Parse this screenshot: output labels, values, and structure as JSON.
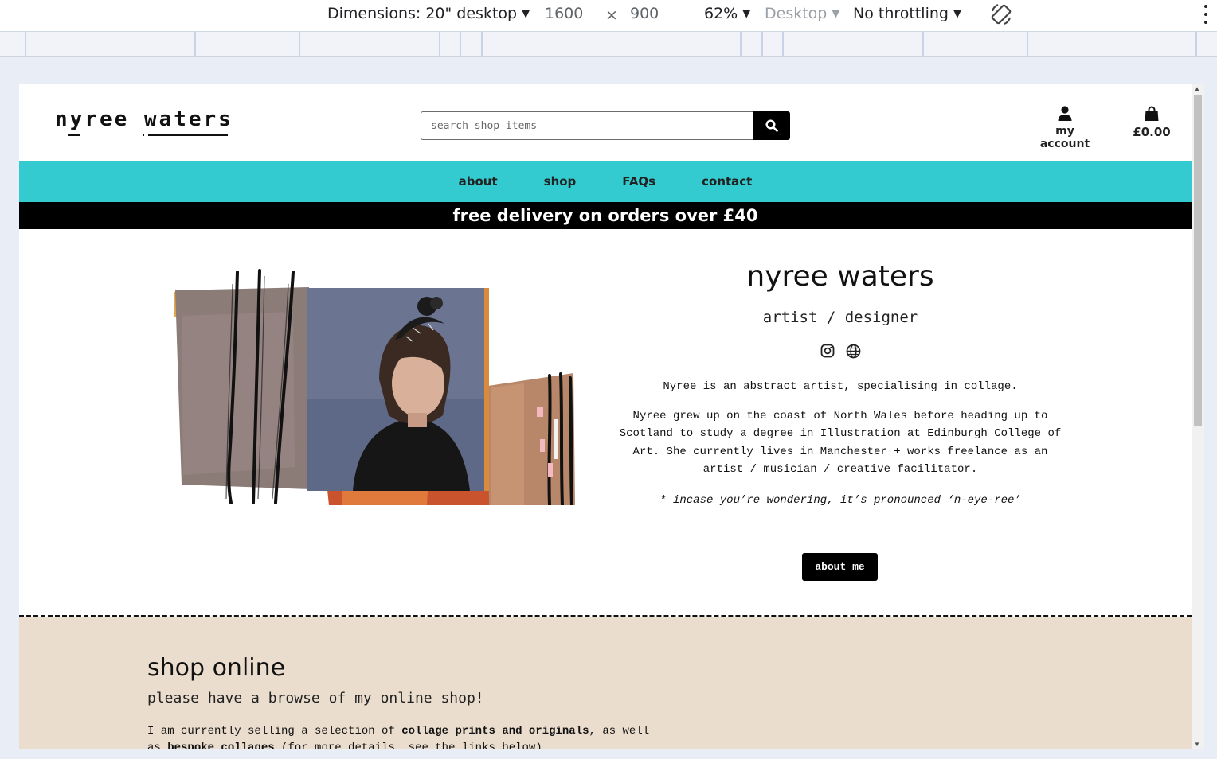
{
  "devtools": {
    "dimensions_label": "Dimensions: 20\" desktop",
    "width": "1600",
    "times": "×",
    "height": "900",
    "zoom": "62%",
    "device_type": "Desktop",
    "throttling": "No throttling"
  },
  "site": {
    "logo_text": "nyree waters",
    "search_placeholder": "search shop items",
    "account_label": "my account",
    "cart_total": "£0.00",
    "nav": [
      "about",
      "shop",
      "FAQs",
      "contact"
    ],
    "banner": "free delivery on orders over £40",
    "accent_color": "#33cbcf"
  },
  "hero": {
    "title": "nyree waters",
    "subtitle": "artist / designer",
    "socials": [
      "instagram-icon",
      "globe-icon"
    ],
    "paragraph1": "Nyree is an abstract artist, specialising in collage.",
    "paragraph2": "Nyree grew up on the coast of North Wales before heading up to Scotland to study a degree in Illustration at Edinburgh College of Art. She currently lives in Manchester + works freelance as an artist / musician / creative facilitator.",
    "paragraph3": "* incase you’re wondering, it’s pronounced ‘n-eye-ree’",
    "button": "about me"
  },
  "shop": {
    "title": "shop online",
    "subtitle": "please have a browse of my online shop!",
    "intro_a": "I am currently selling a selection of ",
    "intro_b": "collage prints and originals",
    "intro_c": ", as well as ",
    "intro_d": "bespoke collages",
    "intro_e": " (for more details, see the links below)"
  }
}
